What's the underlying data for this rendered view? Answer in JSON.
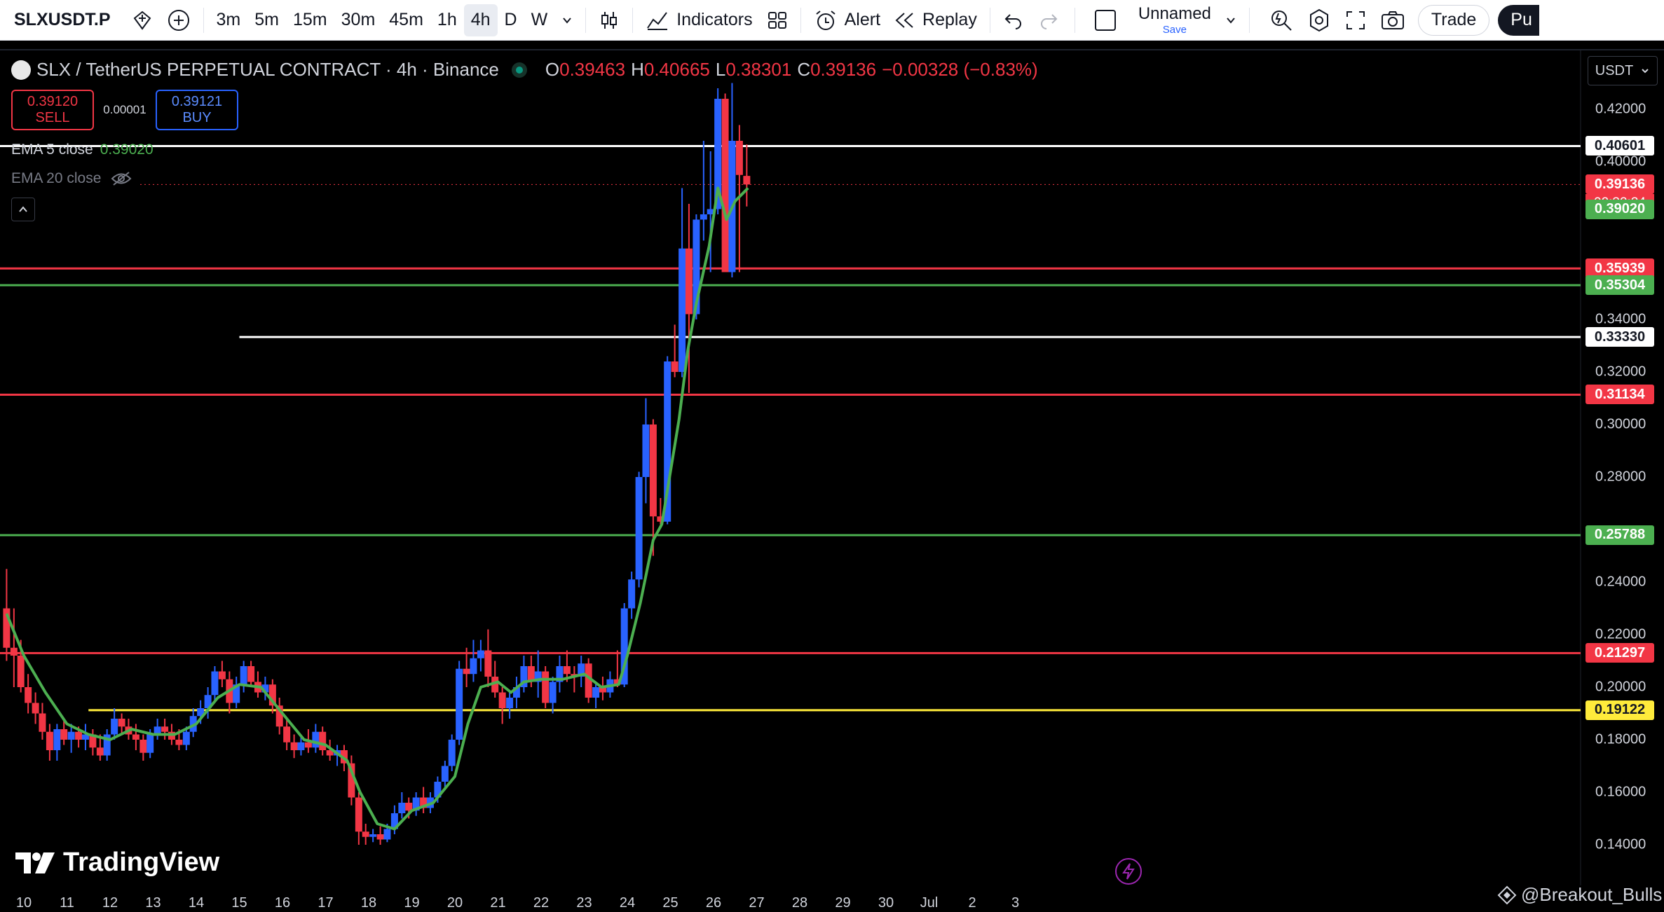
{
  "toolbar": {
    "symbol": "SLXUSDT.P",
    "intervals": [
      {
        "label": "3m",
        "active": false
      },
      {
        "label": "5m",
        "active": false
      },
      {
        "label": "15m",
        "active": false
      },
      {
        "label": "30m",
        "active": false
      },
      {
        "label": "45m",
        "active": false
      },
      {
        "label": "1h",
        "active": false
      },
      {
        "label": "4h",
        "active": true
      },
      {
        "label": "D",
        "active": false
      },
      {
        "label": "W",
        "active": false
      }
    ],
    "indicators_label": "Indicators",
    "alert_label": "Alert",
    "replay_label": "Replay",
    "layout_name": "Unnamed",
    "save_label": "Save",
    "trade_label": "Trade",
    "publish_label": "Pu"
  },
  "legend": {
    "title": "SLX / TetherUS PERPETUAL CONTRACT · 4h · Binance",
    "open_key": "O",
    "open": "0.39463",
    "high_key": "H",
    "high": "0.40665",
    "low_key": "L",
    "low": "0.38301",
    "close_key": "C",
    "close": "0.39136",
    "change": "−0.00328 (−0.83%)"
  },
  "trade_widget": {
    "sell_price": "0.39120",
    "sell_label": "SELL",
    "spread": "0.00001",
    "buy_price": "0.39121",
    "buy_label": "BUY"
  },
  "indicators": {
    "ema5_label": "EMA 5 close",
    "ema5_value": "0.39020",
    "ema20_label": "EMA 20 close"
  },
  "price_axis": {
    "currency": "USDT",
    "ticks": [
      "0.42000",
      "0.40000",
      "0.34000",
      "0.32000",
      "0.30000",
      "0.28000",
      "0.24000",
      "0.22000",
      "0.20000",
      "0.18000",
      "0.16000",
      "0.14000"
    ],
    "countdown": "02:32:34"
  },
  "time_axis": {
    "labels": [
      "10",
      "11",
      "12",
      "13",
      "14",
      "15",
      "16",
      "17",
      "18",
      "19",
      "20",
      "21",
      "22",
      "23",
      "24",
      "25",
      "26",
      "27",
      "28",
      "29",
      "30",
      "Jul",
      "2",
      "3"
    ]
  },
  "horizontal_lines": [
    {
      "price": 0.40601,
      "label": "0.40601",
      "line_color": "#ffffff",
      "label_bg": "#ffffff",
      "label_fg": "#131722",
      "x_start_day": 0
    },
    {
      "price": 0.35939,
      "label": "0.35939",
      "line_color": "#f23645",
      "label_bg": "#f23645",
      "label_fg": "#ffffff",
      "x_start_day": 0
    },
    {
      "price": 0.35304,
      "label": "0.35304",
      "line_color": "#4caf50",
      "label_bg": "#4caf50",
      "label_fg": "#ffffff",
      "x_start_day": 0
    },
    {
      "price": 0.3333,
      "label": "0.33330",
      "line_color": "#ffffff",
      "label_bg": "#ffffff",
      "label_fg": "#131722",
      "x_start_day": 15.0
    },
    {
      "price": 0.31134,
      "label": "0.31134",
      "line_color": "#f23645",
      "label_bg": "#f23645",
      "label_fg": "#ffffff",
      "x_start_day": 0
    },
    {
      "price": 0.25788,
      "label": "0.25788",
      "line_color": "#4caf50",
      "label_bg": "#4caf50",
      "label_fg": "#ffffff",
      "x_start_day": 0
    },
    {
      "price": 0.21297,
      "label": "0.21297",
      "line_color": "#f23645",
      "label_bg": "#f23645",
      "label_fg": "#ffffff",
      "x_start_day": 0
    },
    {
      "price": 0.19122,
      "label": "0.19122",
      "line_color": "#ffeb3b",
      "label_bg": "#ffeb3b",
      "label_fg": "#131722",
      "x_start_day": 11.5
    }
  ],
  "current_price": {
    "price": 0.39136,
    "label": "0.39136",
    "bg": "#f23645"
  },
  "ema5_price": {
    "price": 0.3902,
    "label": "0.39020",
    "bg": "#4caf50"
  },
  "branding": {
    "logo_text": "TradingView",
    "watermark": "@Breakout_Bulls"
  },
  "colors": {
    "up": "#2962ff",
    "down": "#f23645",
    "ema5": "#4caf50"
  },
  "chart_data": {
    "type": "candlestick",
    "timeframe": "4h",
    "x_unit": "day of month (June), fractional",
    "ylim": [
      0.13,
      0.43
    ],
    "candles": [
      {
        "t": 9.6,
        "o": 0.23,
        "h": 0.245,
        "l": 0.21,
        "c": 0.215
      },
      {
        "t": 9.77,
        "o": 0.215,
        "h": 0.23,
        "l": 0.2,
        "c": 0.212
      },
      {
        "t": 9.93,
        "o": 0.212,
        "h": 0.218,
        "l": 0.198,
        "c": 0.2
      },
      {
        "t": 10.1,
        "o": 0.2,
        "h": 0.205,
        "l": 0.19,
        "c": 0.194
      },
      {
        "t": 10.27,
        "o": 0.194,
        "h": 0.198,
        "l": 0.186,
        "c": 0.19
      },
      {
        "t": 10.43,
        "o": 0.19,
        "h": 0.194,
        "l": 0.18,
        "c": 0.183
      },
      {
        "t": 10.6,
        "o": 0.183,
        "h": 0.186,
        "l": 0.172,
        "c": 0.176
      },
      {
        "t": 10.77,
        "o": 0.176,
        "h": 0.186,
        "l": 0.172,
        "c": 0.184
      },
      {
        "t": 10.93,
        "o": 0.184,
        "h": 0.188,
        "l": 0.178,
        "c": 0.18
      },
      {
        "t": 11.1,
        "o": 0.18,
        "h": 0.186,
        "l": 0.175,
        "c": 0.183
      },
      {
        "t": 11.27,
        "o": 0.183,
        "h": 0.185,
        "l": 0.177,
        "c": 0.18
      },
      {
        "t": 11.43,
        "o": 0.18,
        "h": 0.186,
        "l": 0.176,
        "c": 0.182
      },
      {
        "t": 11.6,
        "o": 0.182,
        "h": 0.184,
        "l": 0.174,
        "c": 0.177
      },
      {
        "t": 11.77,
        "o": 0.177,
        "h": 0.182,
        "l": 0.172,
        "c": 0.174
      },
      {
        "t": 11.93,
        "o": 0.174,
        "h": 0.184,
        "l": 0.172,
        "c": 0.182
      },
      {
        "t": 12.1,
        "o": 0.182,
        "h": 0.192,
        "l": 0.18,
        "c": 0.188
      },
      {
        "t": 12.27,
        "o": 0.188,
        "h": 0.19,
        "l": 0.182,
        "c": 0.185
      },
      {
        "t": 12.43,
        "o": 0.185,
        "h": 0.188,
        "l": 0.18,
        "c": 0.182
      },
      {
        "t": 12.6,
        "o": 0.182,
        "h": 0.186,
        "l": 0.176,
        "c": 0.18
      },
      {
        "t": 12.77,
        "o": 0.18,
        "h": 0.182,
        "l": 0.172,
        "c": 0.175
      },
      {
        "t": 12.93,
        "o": 0.175,
        "h": 0.184,
        "l": 0.173,
        "c": 0.182
      },
      {
        "t": 13.1,
        "o": 0.182,
        "h": 0.188,
        "l": 0.18,
        "c": 0.185
      },
      {
        "t": 13.27,
        "o": 0.185,
        "h": 0.188,
        "l": 0.18,
        "c": 0.183
      },
      {
        "t": 13.43,
        "o": 0.183,
        "h": 0.186,
        "l": 0.178,
        "c": 0.18
      },
      {
        "t": 13.6,
        "o": 0.18,
        "h": 0.184,
        "l": 0.176,
        "c": 0.178
      },
      {
        "t": 13.77,
        "o": 0.178,
        "h": 0.185,
        "l": 0.176,
        "c": 0.183
      },
      {
        "t": 13.93,
        "o": 0.183,
        "h": 0.192,
        "l": 0.181,
        "c": 0.189
      },
      {
        "t": 14.1,
        "o": 0.189,
        "h": 0.195,
        "l": 0.186,
        "c": 0.192
      },
      {
        "t": 14.27,
        "o": 0.192,
        "h": 0.2,
        "l": 0.188,
        "c": 0.197
      },
      {
        "t": 14.43,
        "o": 0.197,
        "h": 0.208,
        "l": 0.194,
        "c": 0.206
      },
      {
        "t": 14.6,
        "o": 0.206,
        "h": 0.21,
        "l": 0.2,
        "c": 0.203
      },
      {
        "t": 14.77,
        "o": 0.203,
        "h": 0.206,
        "l": 0.19,
        "c": 0.194
      },
      {
        "t": 14.93,
        "o": 0.194,
        "h": 0.204,
        "l": 0.192,
        "c": 0.201
      },
      {
        "t": 15.1,
        "o": 0.201,
        "h": 0.21,
        "l": 0.198,
        "c": 0.208
      },
      {
        "t": 15.27,
        "o": 0.208,
        "h": 0.21,
        "l": 0.2,
        "c": 0.202
      },
      {
        "t": 15.43,
        "o": 0.202,
        "h": 0.206,
        "l": 0.196,
        "c": 0.198
      },
      {
        "t": 15.6,
        "o": 0.198,
        "h": 0.204,
        "l": 0.195,
        "c": 0.201
      },
      {
        "t": 15.77,
        "o": 0.201,
        "h": 0.203,
        "l": 0.19,
        "c": 0.193
      },
      {
        "t": 15.93,
        "o": 0.193,
        "h": 0.196,
        "l": 0.182,
        "c": 0.185
      },
      {
        "t": 16.1,
        "o": 0.185,
        "h": 0.188,
        "l": 0.176,
        "c": 0.179
      },
      {
        "t": 16.27,
        "o": 0.179,
        "h": 0.182,
        "l": 0.173,
        "c": 0.176
      },
      {
        "t": 16.43,
        "o": 0.176,
        "h": 0.182,
        "l": 0.174,
        "c": 0.179
      },
      {
        "t": 16.6,
        "o": 0.179,
        "h": 0.184,
        "l": 0.175,
        "c": 0.177
      },
      {
        "t": 16.77,
        "o": 0.177,
        "h": 0.186,
        "l": 0.175,
        "c": 0.183
      },
      {
        "t": 16.93,
        "o": 0.183,
        "h": 0.185,
        "l": 0.174,
        "c": 0.176
      },
      {
        "t": 17.1,
        "o": 0.176,
        "h": 0.18,
        "l": 0.172,
        "c": 0.174
      },
      {
        "t": 17.27,
        "o": 0.174,
        "h": 0.178,
        "l": 0.17,
        "c": 0.176
      },
      {
        "t": 17.43,
        "o": 0.176,
        "h": 0.178,
        "l": 0.168,
        "c": 0.171
      },
      {
        "t": 17.6,
        "o": 0.171,
        "h": 0.174,
        "l": 0.155,
        "c": 0.158
      },
      {
        "t": 17.77,
        "o": 0.158,
        "h": 0.16,
        "l": 0.14,
        "c": 0.145
      },
      {
        "t": 17.93,
        "o": 0.145,
        "h": 0.148,
        "l": 0.14,
        "c": 0.143
      },
      {
        "t": 18.1,
        "o": 0.143,
        "h": 0.146,
        "l": 0.141,
        "c": 0.144
      },
      {
        "t": 18.27,
        "o": 0.144,
        "h": 0.147,
        "l": 0.14,
        "c": 0.142
      },
      {
        "t": 18.43,
        "o": 0.142,
        "h": 0.148,
        "l": 0.141,
        "c": 0.146
      },
      {
        "t": 18.6,
        "o": 0.146,
        "h": 0.155,
        "l": 0.144,
        "c": 0.152
      },
      {
        "t": 18.77,
        "o": 0.152,
        "h": 0.16,
        "l": 0.15,
        "c": 0.156
      },
      {
        "t": 18.93,
        "o": 0.156,
        "h": 0.158,
        "l": 0.15,
        "c": 0.153
      },
      {
        "t": 19.1,
        "o": 0.153,
        "h": 0.16,
        "l": 0.151,
        "c": 0.158
      },
      {
        "t": 19.27,
        "o": 0.158,
        "h": 0.162,
        "l": 0.152,
        "c": 0.154
      },
      {
        "t": 19.43,
        "o": 0.154,
        "h": 0.16,
        "l": 0.152,
        "c": 0.158
      },
      {
        "t": 19.6,
        "o": 0.158,
        "h": 0.166,
        "l": 0.156,
        "c": 0.164
      },
      {
        "t": 19.77,
        "o": 0.164,
        "h": 0.172,
        "l": 0.162,
        "c": 0.17
      },
      {
        "t": 19.93,
        "o": 0.17,
        "h": 0.182,
        "l": 0.168,
        "c": 0.18
      },
      {
        "t": 20.1,
        "o": 0.18,
        "h": 0.21,
        "l": 0.178,
        "c": 0.207
      },
      {
        "t": 20.27,
        "o": 0.207,
        "h": 0.215,
        "l": 0.2,
        "c": 0.205
      },
      {
        "t": 20.43,
        "o": 0.205,
        "h": 0.218,
        "l": 0.202,
        "c": 0.211
      },
      {
        "t": 20.6,
        "o": 0.211,
        "h": 0.218,
        "l": 0.206,
        "c": 0.214
      },
      {
        "t": 20.77,
        "o": 0.214,
        "h": 0.222,
        "l": 0.2,
        "c": 0.204
      },
      {
        "t": 20.93,
        "o": 0.204,
        "h": 0.21,
        "l": 0.196,
        "c": 0.198
      },
      {
        "t": 21.1,
        "o": 0.198,
        "h": 0.2,
        "l": 0.186,
        "c": 0.192
      },
      {
        "t": 21.27,
        "o": 0.192,
        "h": 0.198,
        "l": 0.188,
        "c": 0.196
      },
      {
        "t": 21.43,
        "o": 0.196,
        "h": 0.204,
        "l": 0.192,
        "c": 0.2
      },
      {
        "t": 21.6,
        "o": 0.2,
        "h": 0.212,
        "l": 0.198,
        "c": 0.208
      },
      {
        "t": 21.77,
        "o": 0.208,
        "h": 0.212,
        "l": 0.2,
        "c": 0.202
      },
      {
        "t": 21.93,
        "o": 0.202,
        "h": 0.214,
        "l": 0.196,
        "c": 0.206
      },
      {
        "t": 22.1,
        "o": 0.206,
        "h": 0.208,
        "l": 0.192,
        "c": 0.194
      },
      {
        "t": 22.27,
        "o": 0.194,
        "h": 0.204,
        "l": 0.19,
        "c": 0.202
      },
      {
        "t": 22.43,
        "o": 0.202,
        "h": 0.212,
        "l": 0.198,
        "c": 0.208
      },
      {
        "t": 22.6,
        "o": 0.208,
        "h": 0.214,
        "l": 0.202,
        "c": 0.205
      },
      {
        "t": 22.77,
        "o": 0.205,
        "h": 0.208,
        "l": 0.198,
        "c": 0.204
      },
      {
        "t": 22.93,
        "o": 0.204,
        "h": 0.212,
        "l": 0.2,
        "c": 0.209
      },
      {
        "t": 23.1,
        "o": 0.209,
        "h": 0.211,
        "l": 0.194,
        "c": 0.196
      },
      {
        "t": 23.27,
        "o": 0.196,
        "h": 0.202,
        "l": 0.192,
        "c": 0.2
      },
      {
        "t": 23.43,
        "o": 0.2,
        "h": 0.204,
        "l": 0.195,
        "c": 0.198
      },
      {
        "t": 23.6,
        "o": 0.198,
        "h": 0.206,
        "l": 0.196,
        "c": 0.203
      },
      {
        "t": 23.77,
        "o": 0.203,
        "h": 0.214,
        "l": 0.2,
        "c": 0.201
      },
      {
        "t": 23.93,
        "o": 0.201,
        "h": 0.232,
        "l": 0.2,
        "c": 0.23
      },
      {
        "t": 24.1,
        "o": 0.23,
        "h": 0.244,
        "l": 0.226,
        "c": 0.241
      },
      {
        "t": 24.27,
        "o": 0.241,
        "h": 0.282,
        "l": 0.238,
        "c": 0.28
      },
      {
        "t": 24.43,
        "o": 0.28,
        "h": 0.31,
        "l": 0.27,
        "c": 0.3
      },
      {
        "t": 24.6,
        "o": 0.3,
        "h": 0.302,
        "l": 0.25,
        "c": 0.265
      },
      {
        "t": 24.77,
        "o": 0.265,
        "h": 0.272,
        "l": 0.262,
        "c": 0.263
      },
      {
        "t": 24.93,
        "o": 0.263,
        "h": 0.326,
        "l": 0.262,
        "c": 0.324
      },
      {
        "t": 25.1,
        "o": 0.324,
        "h": 0.338,
        "l": 0.318,
        "c": 0.32
      },
      {
        "t": 25.27,
        "o": 0.32,
        "h": 0.39,
        "l": 0.318,
        "c": 0.367
      },
      {
        "t": 25.43,
        "o": 0.367,
        "h": 0.384,
        "l": 0.312,
        "c": 0.342
      },
      {
        "t": 25.6,
        "o": 0.342,
        "h": 0.38,
        "l": 0.34,
        "c": 0.378
      },
      {
        "t": 25.77,
        "o": 0.378,
        "h": 0.408,
        "l": 0.37,
        "c": 0.38
      },
      {
        "t": 25.93,
        "o": 0.38,
        "h": 0.404,
        "l": 0.358,
        "c": 0.382
      },
      {
        "t": 26.1,
        "o": 0.382,
        "h": 0.428,
        "l": 0.38,
        "c": 0.424
      },
      {
        "t": 26.27,
        "o": 0.424,
        "h": 0.426,
        "l": 0.358,
        "c": 0.358
      },
      {
        "t": 26.43,
        "o": 0.358,
        "h": 0.43,
        "l": 0.356,
        "c": 0.408
      },
      {
        "t": 26.6,
        "o": 0.408,
        "h": 0.414,
        "l": 0.358,
        "c": 0.395
      },
      {
        "t": 26.77,
        "o": 0.39463,
        "h": 0.40665,
        "l": 0.38301,
        "c": 0.39136
      }
    ],
    "ema5": [
      [
        9.6,
        0.228
      ],
      [
        10.0,
        0.212
      ],
      [
        10.5,
        0.198
      ],
      [
        11.0,
        0.186
      ],
      [
        11.5,
        0.182
      ],
      [
        12.0,
        0.18
      ],
      [
        12.5,
        0.184
      ],
      [
        13.0,
        0.182
      ],
      [
        13.5,
        0.182
      ],
      [
        14.0,
        0.186
      ],
      [
        14.5,
        0.196
      ],
      [
        15.0,
        0.201
      ],
      [
        15.5,
        0.2
      ],
      [
        16.0,
        0.19
      ],
      [
        16.5,
        0.18
      ],
      [
        17.0,
        0.178
      ],
      [
        17.5,
        0.172
      ],
      [
        17.8,
        0.16
      ],
      [
        18.2,
        0.148
      ],
      [
        18.6,
        0.146
      ],
      [
        19.0,
        0.153
      ],
      [
        19.5,
        0.156
      ],
      [
        20.0,
        0.166
      ],
      [
        20.3,
        0.186
      ],
      [
        20.6,
        0.2
      ],
      [
        21.0,
        0.202
      ],
      [
        21.3,
        0.198
      ],
      [
        21.6,
        0.202
      ],
      [
        22.0,
        0.203
      ],
      [
        22.5,
        0.203
      ],
      [
        23.0,
        0.205
      ],
      [
        23.4,
        0.2
      ],
      [
        23.8,
        0.201
      ],
      [
        24.0,
        0.212
      ],
      [
        24.3,
        0.232
      ],
      [
        24.6,
        0.256
      ],
      [
        24.8,
        0.262
      ],
      [
        25.0,
        0.282
      ],
      [
        25.2,
        0.302
      ],
      [
        25.4,
        0.328
      ],
      [
        25.6,
        0.346
      ],
      [
        25.9,
        0.368
      ],
      [
        26.1,
        0.39
      ],
      [
        26.3,
        0.378
      ],
      [
        26.5,
        0.385
      ],
      [
        26.8,
        0.39
      ]
    ]
  }
}
